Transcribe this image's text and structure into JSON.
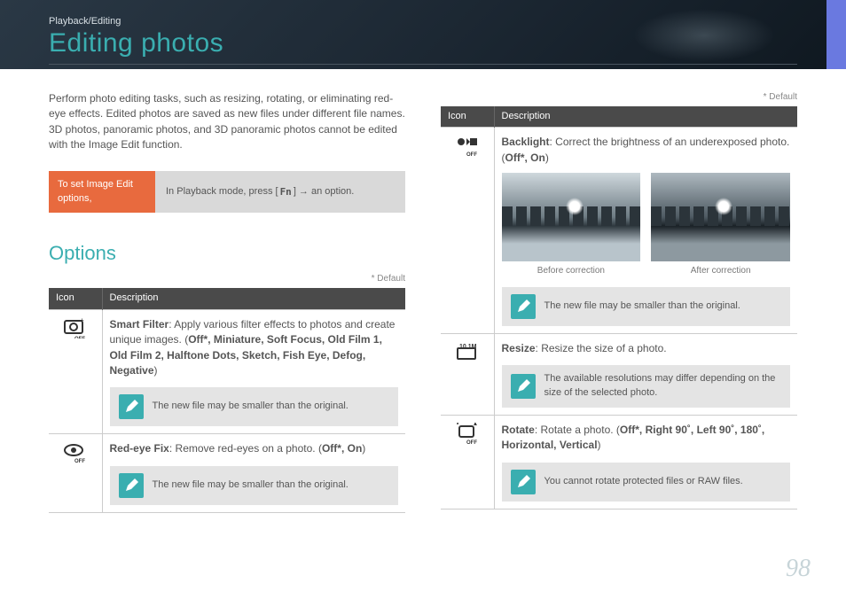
{
  "breadcrumb": "Playback/Editing",
  "page_title": "Editing photos",
  "intro": "Perform photo editing tasks, such as resizing, rotating, or eliminating red-eye effects. Edited photos are saved as new files under different file names. 3D photos, panoramic photos, and 3D panoramic photos cannot be edited with the Image Edit function.",
  "callout": {
    "left": "To set Image Edit options,",
    "right_prefix": "In Playback mode, press [",
    "fn": "Fn",
    "right_suffix": "] → an option."
  },
  "section_title": "Options",
  "default_label": "* Default",
  "table_headers": {
    "icon": "Icon",
    "description": "Description"
  },
  "left_rows": [
    {
      "icon": "smart-filter-icon",
      "title": "Smart Filter",
      "desc": ": Apply various filter effects to photos and create unique images. (",
      "values": "Off*, Miniature, Soft Focus, Old Film 1, Old Film 2, Halftone Dots, Sketch, Fish Eye, Defog, Negative",
      "suffix": ")",
      "note": "The new file may be smaller than the original."
    },
    {
      "icon": "red-eye-icon",
      "title": "Red-eye Fix",
      "desc": ": Remove red-eyes on a photo. (",
      "values": "Off*, On",
      "suffix": ")",
      "note": "The new file may be smaller than the original."
    }
  ],
  "right_rows": [
    {
      "icon": "backlight-icon",
      "title": "Backlight",
      "desc": ": Correct the brightness of an underexposed photo. (",
      "values": "Off*, On",
      "suffix": ")",
      "before_caption": "Before correction",
      "after_caption": "After correction",
      "note": "The new file may be smaller than the original."
    },
    {
      "icon": "resize-icon",
      "title": "Resize",
      "desc": ": Resize the size of a photo.",
      "note": "The available resolutions may differ depending on the size of the selected photo."
    },
    {
      "icon": "rotate-icon",
      "title": "Rotate",
      "desc": ": Rotate a photo. (",
      "values": "Off*, Right 90˚, Left 90˚, 180˚, Horizontal, Vertical",
      "suffix": ")",
      "note": "You cannot rotate protected files or RAW files."
    }
  ],
  "page_number": "98"
}
